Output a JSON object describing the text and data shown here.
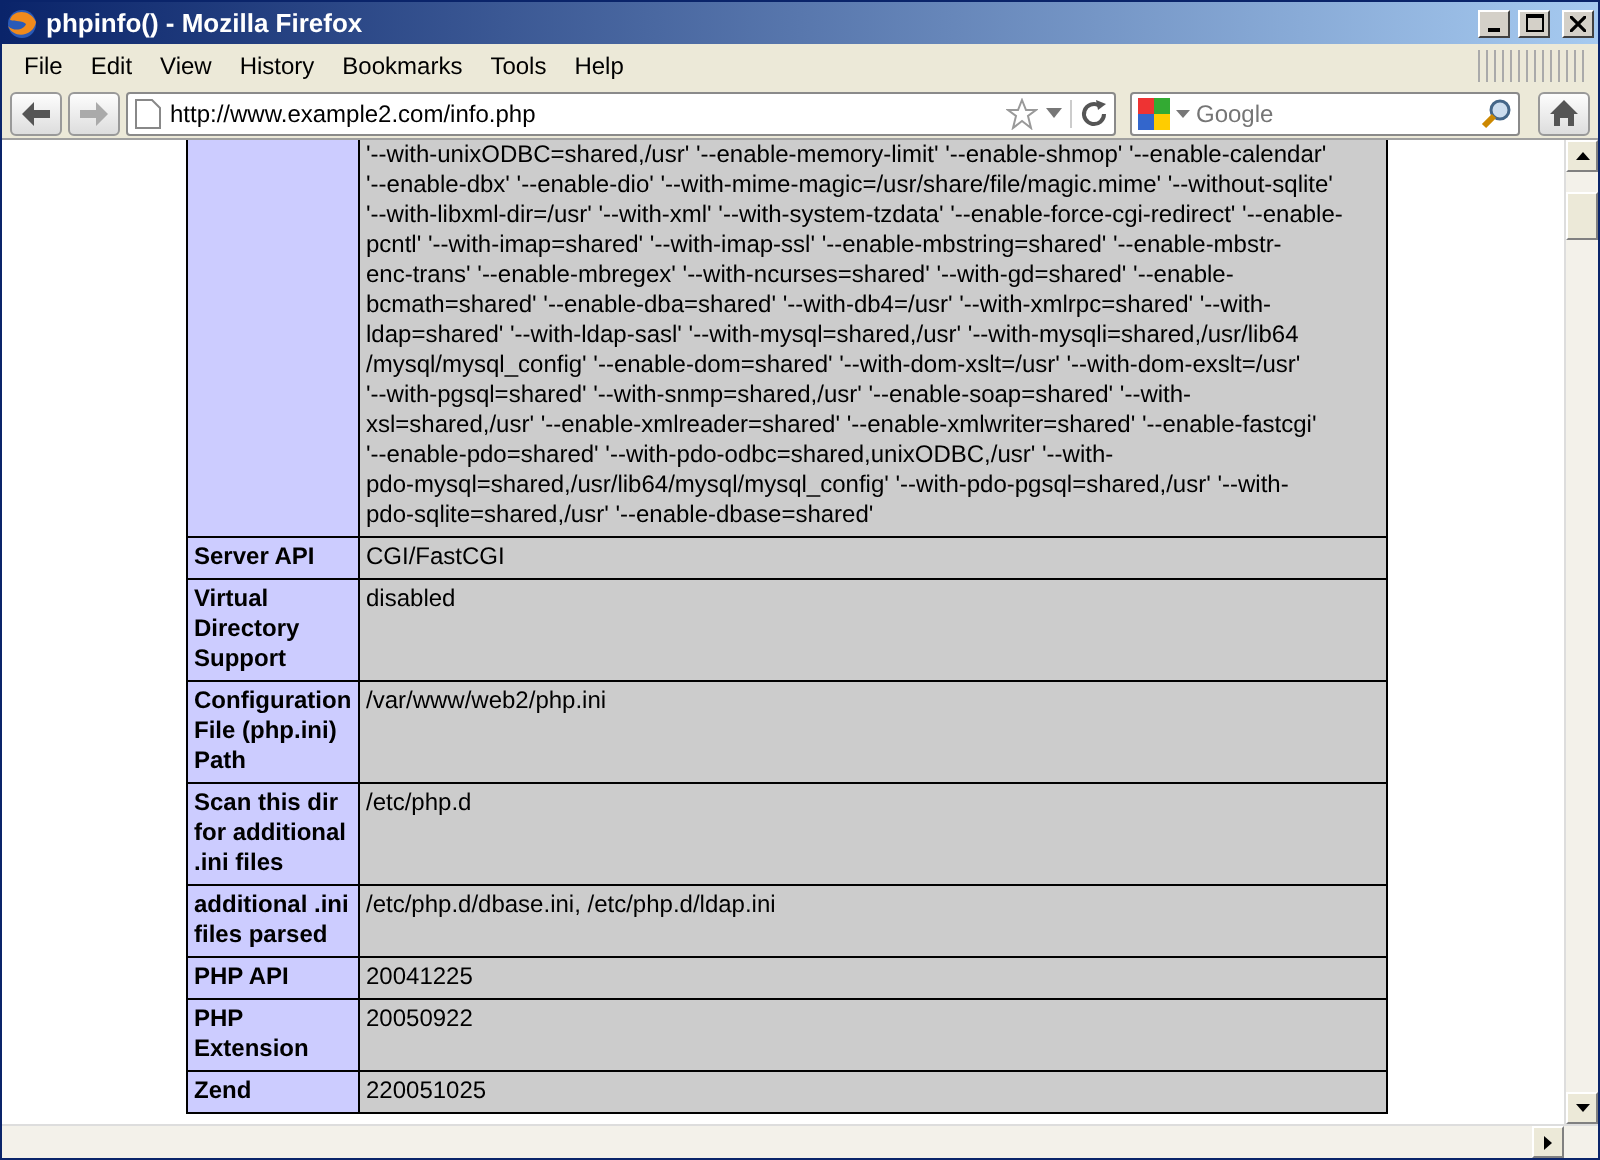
{
  "window": {
    "title": "phpinfo() - Mozilla Firefox"
  },
  "menu": [
    "File",
    "Edit",
    "View",
    "History",
    "Bookmarks",
    "Tools",
    "Help"
  ],
  "toolbar": {
    "url": "http://www.example2.com/info.php",
    "search_placeholder": "Google"
  },
  "table": {
    "rows": [
      {
        "lines": [
          "'--with-unixODBC=shared,/usr' '--enable-memory-limit' '--enable-shmop' '--enable-calendar'",
          "'--enable-dbx' '--enable-dio' '--with-mime-magic=/usr/share/file/magic.mime' '--without-sqlite'",
          "'--with-libxml-dir=/usr' '--with-xml' '--with-system-tzdata' '--enable-force-cgi-redirect' '--enable-",
          "pcntl' '--with-imap=shared' '--with-imap-ssl' '--enable-mbstring=shared' '--enable-mbstr-",
          "enc-trans' '--enable-mbregex' '--with-ncurses=shared' '--with-gd=shared' '--enable-",
          "bcmath=shared' '--enable-dba=shared' '--with-db4=/usr' '--with-xmlrpc=shared' '--with-",
          "ldap=shared' '--with-ldap-sasl' '--with-mysql=shared,/usr' '--with-mysqli=shared,/usr/lib64",
          "/mysql/mysql_config' '--enable-dom=shared' '--with-dom-xslt=/usr' '--with-dom-exslt=/usr'",
          "'--with-pgsql=shared' '--with-snmp=shared,/usr' '--enable-soap=shared' '--with-",
          "xsl=shared,/usr' '--enable-xmlreader=shared' '--enable-xmlwriter=shared' '--enable-fastcgi'",
          "'--enable-pdo=shared' '--with-pdo-odbc=shared,unixODBC,/usr' '--with-",
          "pdo-mysql=shared,/usr/lib64/mysql/mysql_config' '--with-pdo-pgsql=shared,/usr' '--with-",
          "pdo-sqlite=shared,/usr' '--enable-dbase=shared'"
        ]
      },
      {
        "label": "Server API",
        "lines": [
          "CGI/FastCGI"
        ]
      },
      {
        "label": "Virtual Directory Support",
        "lines": [
          "disabled"
        ]
      },
      {
        "label": "Configuration File (php.ini) Path",
        "lines": [
          "/var/www/web2/php.ini"
        ]
      },
      {
        "label": "Scan this dir for additional .ini files",
        "lines": [
          "/etc/php.d"
        ]
      },
      {
        "label": "additional .ini files parsed",
        "lines": [
          "/etc/php.d/dbase.ini, /etc/php.d/ldap.ini"
        ]
      },
      {
        "label": "PHP API",
        "lines": [
          "20041225"
        ]
      },
      {
        "label": "PHP Extension",
        "lines": [
          "20050922"
        ]
      },
      {
        "label": "Zend",
        "lines": [
          "220051025"
        ]
      }
    ]
  }
}
